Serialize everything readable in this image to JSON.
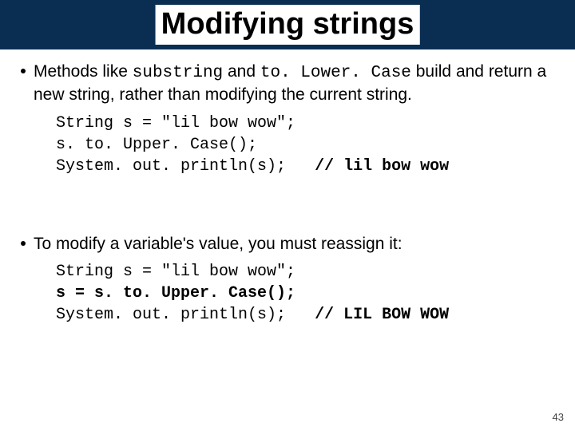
{
  "title": "Modifying strings",
  "bullets": {
    "b1_pre": "Methods like ",
    "b1_code1": "substring",
    "b1_mid": " and ",
    "b1_code2": "to. Lower. Case",
    "b1_post": " build and return a new string, rather than modifying the current string.",
    "b2": "To modify a variable's value, you must reassign it:"
  },
  "code1": {
    "l1": "String s = \"lil bow wow\";",
    "l2": "s. to. Upper. Case();",
    "l3a": "System. out. println(s);   ",
    "l3b": "// lil bow wow"
  },
  "code2": {
    "l1": "String s = \"lil bow wow\";",
    "l2": "s = s. to. Upper. Case();",
    "l3a": "System. out. println(s);   ",
    "l3b": "// LIL BOW WOW"
  },
  "page": "43"
}
